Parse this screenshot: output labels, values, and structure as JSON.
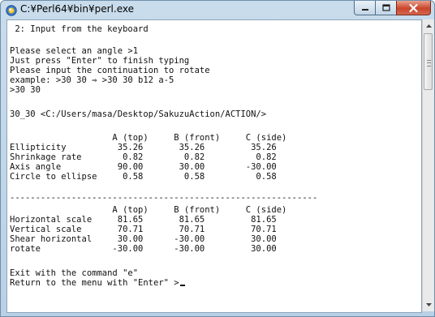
{
  "window": {
    "title": "C:¥Perl64¥bin¥perl.exe",
    "icon": "perl-app-icon",
    "controls": {
      "minimize": "minimize-icon",
      "maximize": "maximize-icon",
      "close": "close-icon"
    }
  },
  "console": {
    "lines": [
      " 2: Input from the keyboard",
      "",
      "Please select an angle >1",
      "Just press \"Enter\" to finish typing",
      "Please input the continuation to rotate",
      "example: >30 30 ⇒ >30 30 b12 a-5",
      ">30 30",
      "",
      "30_30 <C:/Users/masa/Desktop/SakuzuAction/ACTION/>",
      "",
      "                    A (top)     B (front)     C (side)",
      "Ellipticity          35.26       35.26         35.26",
      "Shrinkage rate        0.82        0.82          0.82",
      "Axis angle           90.00       30.00        -30.00",
      "Circle to ellipse     0.58        0.58          0.58",
      "",
      "------------------------------------------------------------",
      "                    A (top)     B (front)     C (side)",
      "Horizontal scale     81.65       81.65         81.65",
      "Vertical scale       70.71       70.71         70.71",
      "Shear horizontal     30.00      -30.00         30.00",
      "rotate              -30.00      -30.00         30.00",
      "",
      "Exit with the command \"e\"",
      "Return to the menu with \"Enter\" >"
    ]
  }
}
